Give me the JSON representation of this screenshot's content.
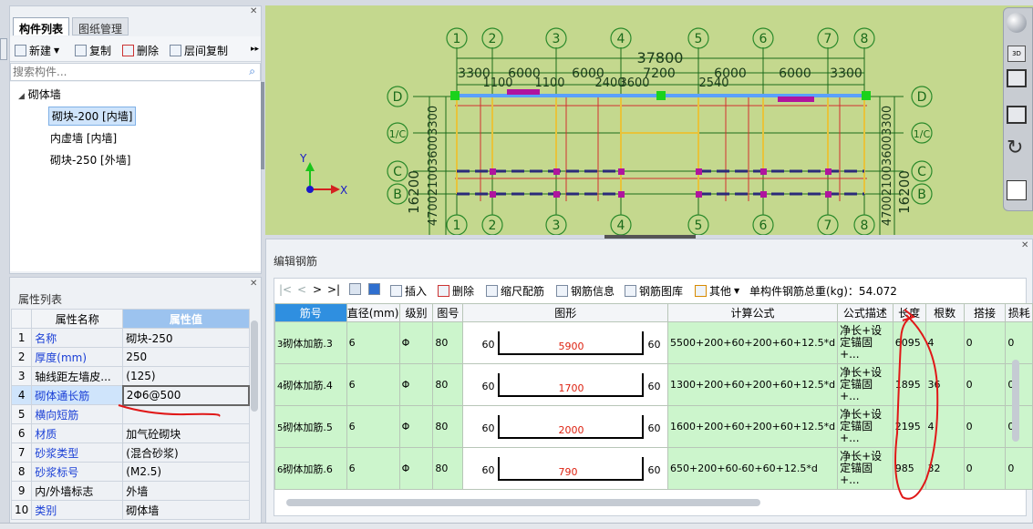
{
  "left_panel": {
    "tabs": [
      "构件列表",
      "图纸管理"
    ],
    "toolbar": {
      "new": "新建",
      "copy": "复制",
      "delete": "删除",
      "floor_copy": "层间复制"
    },
    "search_placeholder": "搜索构件...",
    "tree": {
      "root": "砌体墙",
      "items": [
        "砌块-200 [内墙]",
        "内虚墙 [内墙]",
        "砌块-250 [外墙]"
      ]
    }
  },
  "properties": {
    "title": "属性列表",
    "headers": [
      "属性名称",
      "属性值"
    ],
    "rows": [
      {
        "n": "1",
        "key": "名称",
        "val": "砌块-250"
      },
      {
        "n": "2",
        "key": "厚度(mm)",
        "val": "250"
      },
      {
        "n": "3",
        "key": "轴线距左墙皮...",
        "val": "(125)"
      },
      {
        "n": "4",
        "key": "砌体通长筋",
        "val": "2Φ6@500"
      },
      {
        "n": "5",
        "key": "横向短筋",
        "val": ""
      },
      {
        "n": "6",
        "key": "材质",
        "val": "加气砼砌块"
      },
      {
        "n": "7",
        "key": "砂浆类型",
        "val": "(混合砂浆)"
      },
      {
        "n": "8",
        "key": "砂浆标号",
        "val": "(M2.5)"
      },
      {
        "n": "9",
        "key": "内/外墙标志",
        "val": "外墙"
      },
      {
        "n": "10",
        "key": "类别",
        "val": "砌体墙"
      }
    ]
  },
  "drawing": {
    "top_axes": [
      "1",
      "2",
      "3",
      "4",
      "5",
      "6",
      "7",
      "8"
    ],
    "left_axes": [
      "D",
      "1/C",
      "C",
      "B"
    ],
    "right_axes": [
      "D",
      "1/C",
      "C",
      "B"
    ],
    "total_dim": "37800",
    "dims_top": [
      "3300",
      "6000",
      "6000",
      "7200",
      "6000",
      "6000",
      "3300"
    ],
    "dims_overlap": [
      "1100",
      "1100",
      "2400",
      "3600",
      "2540"
    ],
    "dim_left_outer": "16200",
    "dim_left_inner": "4700210036003300",
    "dim_right_outer": "16200",
    "dim_right_inner": "4700210036003300",
    "coord_x": "X",
    "coord_y": "Y",
    "background": "#c4d88e"
  },
  "rebar": {
    "title": "编辑钢筋",
    "toolbar": {
      "nav": [
        "|<",
        "<",
        ">",
        ">|"
      ],
      "insert": "插入",
      "delete": "删除",
      "scale": "缩尺配筋",
      "info": "钢筋信息",
      "library": "钢筋图库",
      "other": "其他",
      "total": "单构件钢筋总重(kg)：54.072"
    },
    "headers": [
      "筋号",
      "直径(mm)",
      "级别",
      "图号",
      "图形",
      "计算公式",
      "公式描述",
      "长度",
      "根数",
      "搭接",
      "损耗"
    ],
    "rows": [
      {
        "idx": "3",
        "name": "砌体加筋.3",
        "dia": "6",
        "grade": "Φ",
        "fig": "80",
        "left": "60",
        "mid": "5900",
        "right": "60",
        "formula": "5500+200+60+200+60+12.5*d",
        "desc": "净长+设定锚固+...",
        "len": "6095",
        "count": "4",
        "lap": "0",
        "loss": "0"
      },
      {
        "idx": "4",
        "name": "砌体加筋.4",
        "dia": "6",
        "grade": "Φ",
        "fig": "80",
        "left": "60",
        "mid": "1700",
        "right": "60",
        "formula": "1300+200+60+200+60+12.5*d",
        "desc": "净长+设定锚固+...",
        "len": "1895",
        "count": "36",
        "lap": "0",
        "loss": "0"
      },
      {
        "idx": "5",
        "name": "砌体加筋.5",
        "dia": "6",
        "grade": "Φ",
        "fig": "80",
        "left": "60",
        "mid": "2000",
        "right": "60",
        "formula": "1600+200+60+200+60+12.5*d",
        "desc": "净长+设定锚固+...",
        "len": "2195",
        "count": "4",
        "lap": "0",
        "loss": "0"
      },
      {
        "idx": "6",
        "name": "砌体加筋.6",
        "dia": "6",
        "grade": "Φ",
        "fig": "80",
        "left": "60",
        "mid": "790",
        "right": "60",
        "formula": "650+200+60-60+60+12.5*d",
        "desc": "净长+设定锚固+...",
        "len": "985",
        "count": "32",
        "lap": "0",
        "loss": "0"
      }
    ]
  },
  "accent": "#2f8fe0",
  "annotation_color": "#e01818"
}
